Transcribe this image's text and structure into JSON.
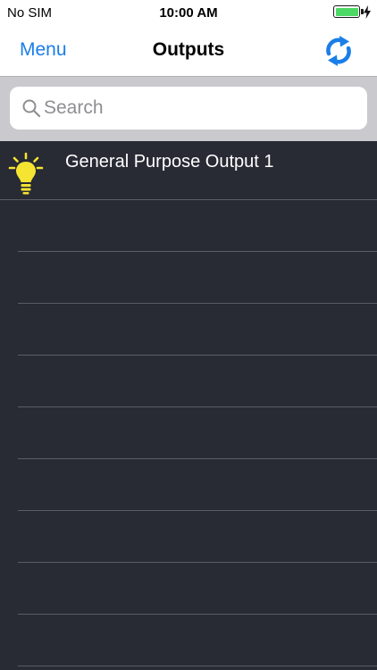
{
  "status_bar": {
    "carrier": "No SIM",
    "time": "10:00 AM",
    "battery_color": "#4cd964"
  },
  "nav": {
    "menu_label": "Menu",
    "title": "Outputs",
    "refresh_icon": "refresh-icon",
    "accent_color": "#1a7ee8"
  },
  "search": {
    "placeholder": "Search",
    "value": ""
  },
  "outputs": {
    "items": [
      {
        "label": "General Purpose Output 1",
        "icon": "lightbulb-icon"
      }
    ],
    "empty_rows": 9
  }
}
